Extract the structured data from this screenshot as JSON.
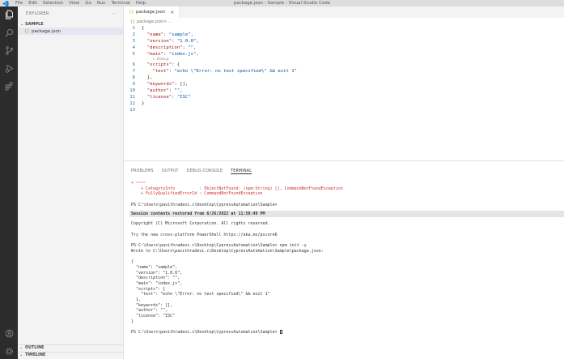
{
  "titlebar": {
    "menu": [
      "File",
      "Edit",
      "Selection",
      "View",
      "Go",
      "Run",
      "Terminal",
      "Help"
    ],
    "window_title": "package.json - Sample - Visual Studio Code",
    "logo_color": "#0078d4"
  },
  "sidebar": {
    "header": "EXPLORER",
    "more": "···",
    "folder": "SAMPLE",
    "file": "package.json",
    "file_brace": "{}",
    "outline": "OUTLINE",
    "timeline": "TIMELINE"
  },
  "editor": {
    "tab_label": "package.json",
    "tab_brace": "{}",
    "tab_close": "×",
    "breadcrumb_file": "package.json",
    "breadcrumb_rest": " > ...",
    "codelens": "▷ Debug",
    "lines": [
      {
        "n": "1",
        "t": "{"
      },
      {
        "n": "2",
        "t": "  \"name\": \"sample\","
      },
      {
        "n": "3",
        "t": "  \"version\": \"1.0.0\","
      },
      {
        "n": "4",
        "t": "  \"description\": \"\","
      },
      {
        "n": "5",
        "t": "  \"main\": \"index.js\","
      },
      {
        "n": "6",
        "t": "  \"scripts\": {"
      },
      {
        "n": "7",
        "t": "    \"test\": \"echo \\\"Error: no test specified\\\" && exit 1\""
      },
      {
        "n": "8",
        "t": "  },"
      },
      {
        "n": "9",
        "t": "  \"keywords\": [],"
      },
      {
        "n": "10",
        "t": "  \"author\": \"\","
      },
      {
        "n": "11",
        "t": "  \"license\": \"ISC\""
      },
      {
        "n": "12",
        "t": "}"
      },
      {
        "n": "13",
        "t": ""
      }
    ]
  },
  "panel": {
    "tabs": [
      "PROBLEMS",
      "OUTPUT",
      "DEBUG CONSOLE",
      "TERMINAL"
    ],
    "active_tab": "TERMINAL",
    "err_lines": [
      "+ ~~~~",
      "    + CategoryInfo          : ObjectNotFound: (npm:String) [], CommandNotFoundException",
      "    + FullyQualifiedErrorId : CommandNotFoundException"
    ],
    "prompt1": "PS C:\\Users\\pavithradevi.c\\Desktop\\CypressAutomation\\Sample>",
    "session": "Session contents restored from 6/26/2022 at 11:58:49 PM",
    "copyright": "Copyright (C) Microsoft Corporation. All rights reserved.",
    "try_line": "Try the new cross-platform PowerShell https://aka.ms/pscore6",
    "npm_cmd": "PS C:\\Users\\pavithradevi.c\\Desktop\\CypressAutomation\\Sample> npm init -y",
    "wrote": "Wrote to C:\\Users\\pavithradevi.c\\Desktop\\CypressAutomation\\Sample\\package.json:",
    "json_lines": [
      "{",
      "  \"name\": \"sample\",",
      "  \"version\": \"1.0.0\",",
      "  \"description\": \"\",",
      "  \"main\": \"index.js\",",
      "  \"scripts\": {",
      "    \"test\": \"echo \\\"Error: no test specified\\\" && exit 1\"",
      "  },",
      "  \"keywords\": [],",
      "  \"author\": \"\",",
      "  \"license\": \"ISC\"",
      "}"
    ],
    "final_prompt": "PS C:\\Users\\pavithradevi.c\\Desktop\\CypressAutomation\\Sample> "
  }
}
